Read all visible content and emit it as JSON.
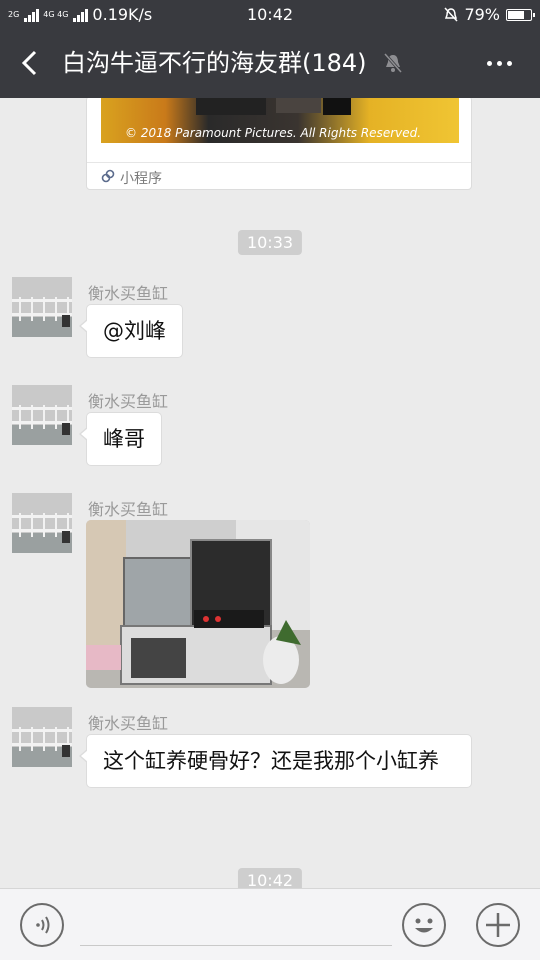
{
  "status": {
    "sim_labels": [
      "2G",
      "4G 4G"
    ],
    "speed": "0.19K/s",
    "time": "10:42",
    "battery_text": "79%",
    "battery_level": 0.79
  },
  "header": {
    "title": "白沟牛逼不行的海友群(184)",
    "muted": true
  },
  "miniprogram": {
    "copyright": "© 2018 Paramount Pictures. All Rights Reserved.",
    "label": "小程序"
  },
  "timestamps": [
    "10:33",
    "10:42"
  ],
  "messages": [
    {
      "sender": "衡水买鱼缸",
      "type": "text",
      "text": "@刘峰"
    },
    {
      "sender": "衡水买鱼缸",
      "type": "text",
      "text": "峰哥"
    },
    {
      "sender": "衡水买鱼缸",
      "type": "image"
    },
    {
      "sender": "衡水买鱼缸",
      "type": "text",
      "text": "这个缸养硬骨好？还是我那个小缸养"
    }
  ],
  "icons": {
    "back": "back-arrow-icon",
    "mute": "bell-off-icon",
    "more": "more-dots-icon",
    "voice": "voice-icon",
    "emoji": "emoji-icon",
    "plus": "plus-icon",
    "link": "miniprogram-link-icon"
  },
  "colors": {
    "bar_bg": "#393a3f",
    "chat_bg": "#ebebeb",
    "bubble_bg": "#ffffff",
    "timestamp_bg": "#cecece"
  }
}
